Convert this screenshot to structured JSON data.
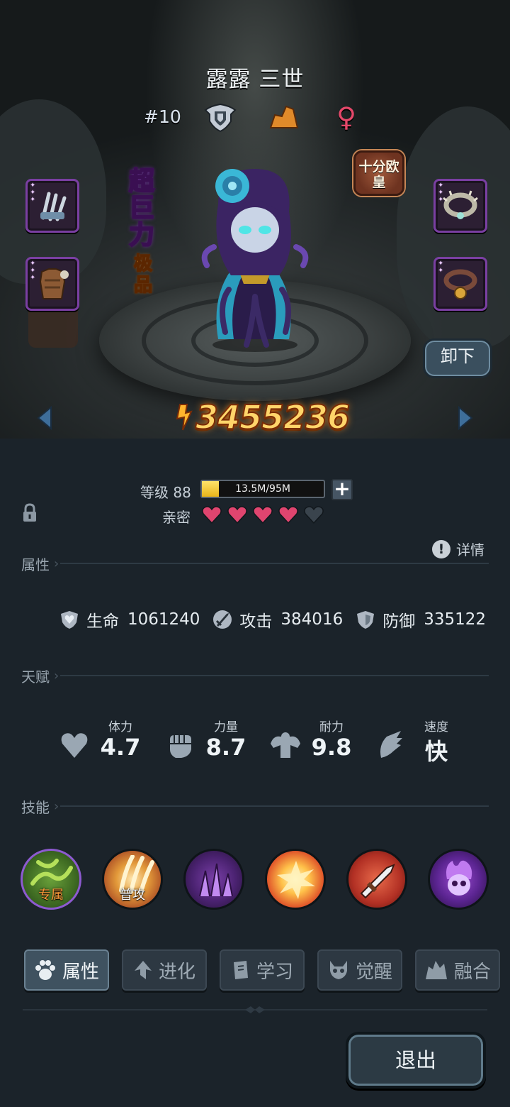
{
  "hero": {
    "name": "露露 三世",
    "rank": "#10",
    "gender_symbol": "♀",
    "power": "3455236",
    "tag_super": "超巨力",
    "tag_quality": "极品",
    "luck_badge": "十分欧皇",
    "unequip_label": "卸下"
  },
  "status": {
    "level_label": "等级 88",
    "xp_text": "13.5M/95M",
    "xp_progress": 0.142,
    "intimacy_label": "亲密",
    "hearts_filled": 4,
    "hearts_total": 5
  },
  "sections": {
    "attributes": "属性",
    "talents": "天赋",
    "skills": "技能",
    "details": "详情"
  },
  "stats": [
    {
      "name": "生命",
      "value": "1061240",
      "icon": "shield-heart-icon"
    },
    {
      "name": "攻击",
      "value": "384016",
      "icon": "sword-icon"
    },
    {
      "name": "防御",
      "value": "335122",
      "icon": "shield-icon"
    }
  ],
  "talents": [
    {
      "name": "体力",
      "value": "4.7",
      "icon": "heart-icon"
    },
    {
      "name": "力量",
      "value": "8.7",
      "icon": "fist-icon"
    },
    {
      "name": "耐力",
      "value": "9.8",
      "icon": "muscle-icon"
    },
    {
      "name": "速度",
      "value": "快",
      "icon": "wing-icon"
    }
  ],
  "skills": [
    {
      "label": "专属",
      "icon": "thorn-skill-icon"
    },
    {
      "label": "普攻",
      "icon": "claw-skill-icon"
    },
    {
      "label": "",
      "icon": "shadow-spike-skill-icon"
    },
    {
      "label": "",
      "icon": "explosion-skill-icon"
    },
    {
      "label": "",
      "icon": "sword-skill-icon"
    },
    {
      "label": "",
      "icon": "skull-flame-skill-icon"
    }
  ],
  "tabs": [
    {
      "label": "属性",
      "icon": "paw-icon",
      "active": true
    },
    {
      "label": "进化",
      "icon": "arrow-up-icon",
      "active": false
    },
    {
      "label": "学习",
      "icon": "book-icon",
      "active": false
    },
    {
      "label": "觉醒",
      "icon": "demon-icon",
      "active": false
    },
    {
      "label": "融合",
      "icon": "fusion-icon",
      "active": false
    }
  ],
  "exit_label": "退出",
  "colors": {
    "power_text": "#ffd56a",
    "heart_active": "#e0456f",
    "heart_inactive": "#3a444d",
    "slot_border": "#7a3fa2",
    "xp_fill": "#f2c82e"
  }
}
